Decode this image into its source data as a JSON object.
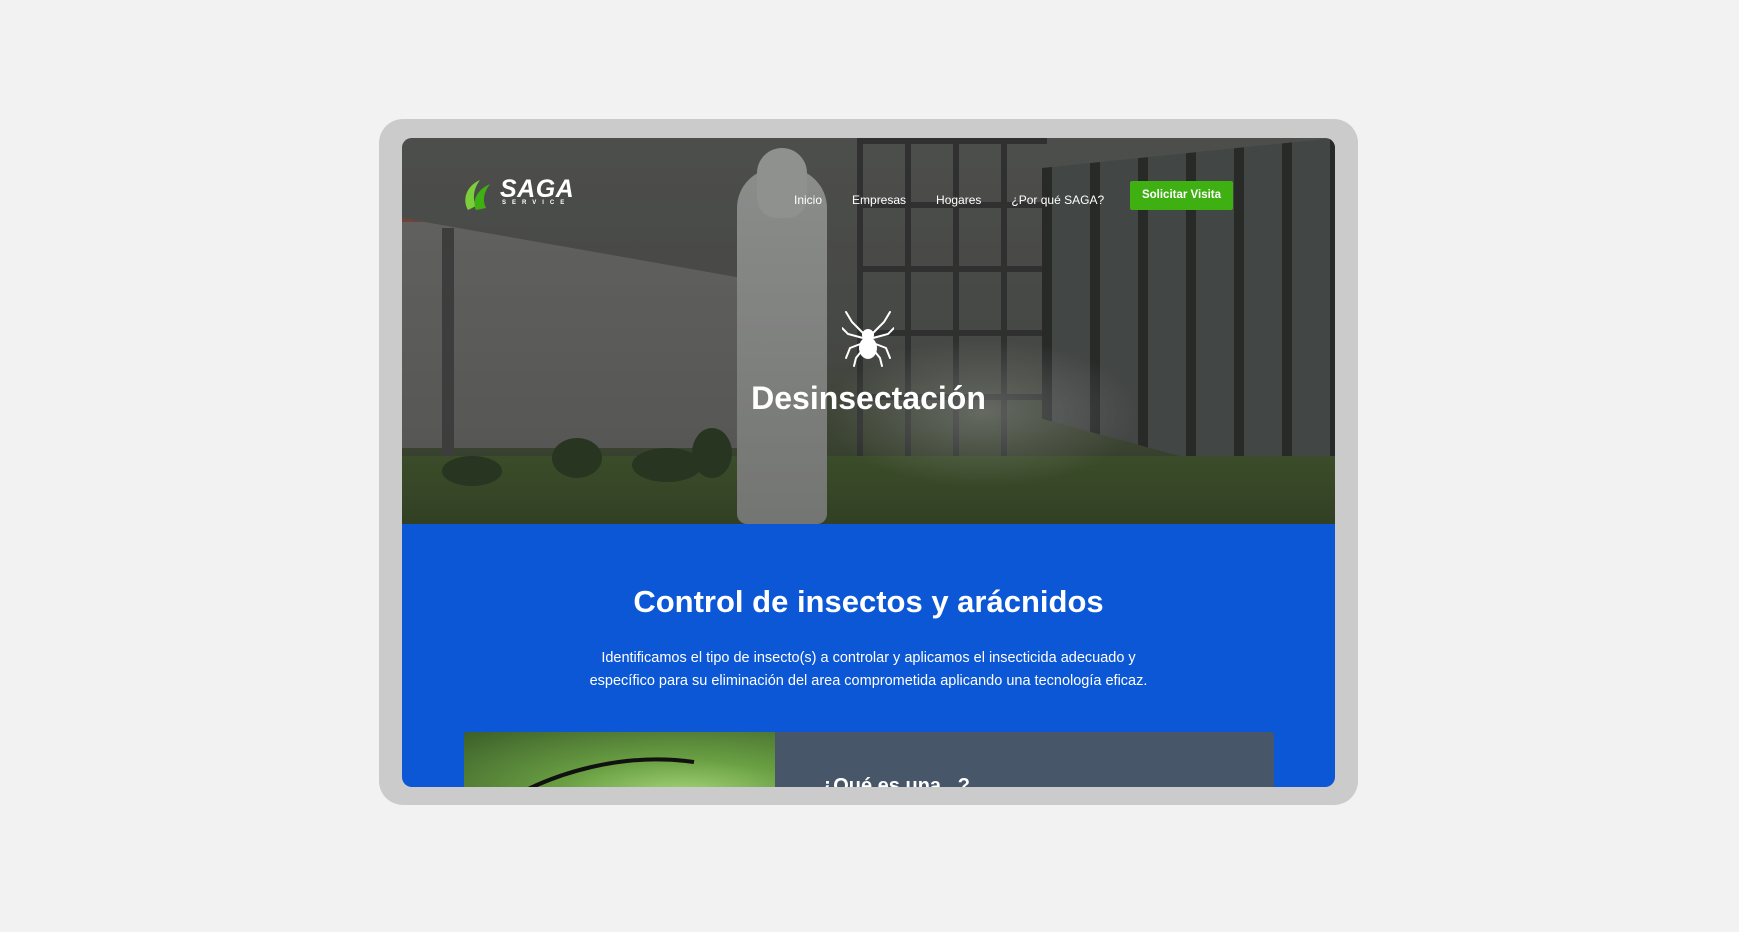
{
  "brand": {
    "name": "SAGA",
    "tagline": "SERVICE",
    "accent_green": "#3eb012",
    "blue": "#0c57d6",
    "card_gray": "#475668"
  },
  "nav": {
    "items": [
      "Inicio",
      "Empresas",
      "Hogares",
      "¿Por qué SAGA?"
    ],
    "cta_label": "Solicitar Visita"
  },
  "hero": {
    "icon": "spider-icon",
    "title": "Desinsectación"
  },
  "section": {
    "title": "Control de insectos y arácnidos",
    "description": "Identificamos el tipo de insecto(s) a controlar y aplicamos el insecticida adecuado y específico para su eliminación del area comprometida aplicando una tecnología eficaz."
  },
  "card": {
    "heading": "¿Qué es una...?"
  }
}
